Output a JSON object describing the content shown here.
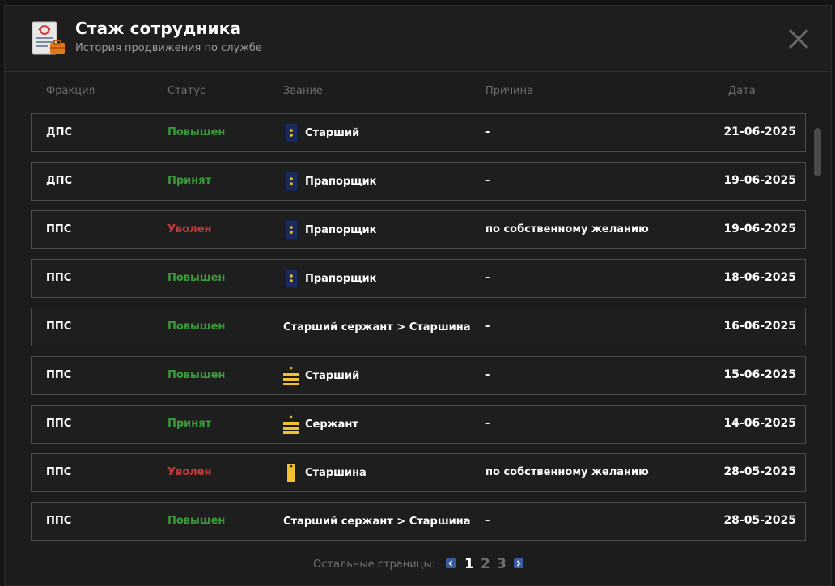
{
  "header": {
    "title": "Стаж сотрудника",
    "subtitle": "История продвижения по службе",
    "icon": "document-briefcase-icon",
    "close_icon": "close-icon"
  },
  "columns": {
    "faction": "Фракция",
    "status": "Статус",
    "rank": "Звание",
    "reason": "Причина",
    "date": "Дата"
  },
  "rows": [
    {
      "faction": "ДПС",
      "status": "Повышен",
      "status_color": "#3a9a3a",
      "insignia": "blue-stars-icon",
      "rank": "Старший",
      "reason": "-",
      "date": "21-06-2025"
    },
    {
      "faction": "ДПС",
      "status": "Принят",
      "status_color": "#3a9a3a",
      "insignia": "blue-stars-icon",
      "rank": "Прапорщик",
      "reason": "-",
      "date": "19-06-2025"
    },
    {
      "faction": "ППС",
      "status": "Уволен",
      "status_color": "#c23a3a",
      "insignia": "blue-stars-icon",
      "rank": "Прапорщик",
      "reason": "по собственному желанию",
      "date": "19-06-2025"
    },
    {
      "faction": "ППС",
      "status": "Повышен",
      "status_color": "#3a9a3a",
      "insignia": "blue-stars-icon",
      "rank": "Прапорщик",
      "reason": "-",
      "date": "18-06-2025"
    },
    {
      "faction": "ППС",
      "status": "Повышен",
      "status_color": "#3a9a3a",
      "insignia": "",
      "rank": "Старший сержант > Старшина",
      "reason": "-",
      "date": "16-06-2025"
    },
    {
      "faction": "ППС",
      "status": "Повышен",
      "status_color": "#3a9a3a",
      "insignia": "yellow-stripes-icon",
      "rank": "Старший",
      "reason": "-",
      "date": "15-06-2025"
    },
    {
      "faction": "ППС",
      "status": "Принят",
      "status_color": "#3a9a3a",
      "insignia": "yellow-stripes-icon",
      "rank": "Сержант",
      "reason": "-",
      "date": "14-06-2025"
    },
    {
      "faction": "ППС",
      "status": "Уволен",
      "status_color": "#c23a3a",
      "insignia": "yellow-bar-icon",
      "rank": "Старшина",
      "reason": "по собственному желанию",
      "date": "28-05-2025"
    },
    {
      "faction": "ППС",
      "status": "Повышен",
      "status_color": "#3a9a3a",
      "insignia": "",
      "rank": "Старший сержант > Старшина",
      "reason": "-",
      "date": "28-05-2025"
    }
  ],
  "pagination": {
    "label": "Остальные страницы:",
    "pages": [
      "1",
      "2",
      "3"
    ],
    "current": "1",
    "prev_icon": "chevron-left-icon",
    "next_icon": "chevron-right-icon"
  }
}
